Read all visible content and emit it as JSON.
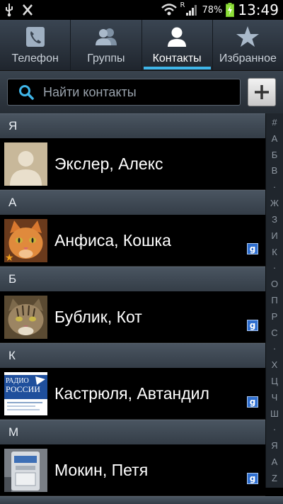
{
  "status_bar": {
    "icons_left": [
      "usb-icon",
      "debug-icon"
    ],
    "signal_label": "R",
    "battery_percent": "78%",
    "time": "13:49"
  },
  "tabs": [
    {
      "label": "Телефон",
      "icon": "phone-icon",
      "active": false
    },
    {
      "label": "Группы",
      "icon": "groups-icon",
      "active": false
    },
    {
      "label": "Контакты",
      "icon": "contact-icon",
      "active": true
    },
    {
      "label": "Избранное",
      "icon": "star-icon",
      "active": false
    }
  ],
  "search": {
    "placeholder": "Найти контакты",
    "add_label": "+"
  },
  "sections": [
    {
      "letter": "Я",
      "contacts": [
        {
          "name": "Экслер, Алекс",
          "avatar": "placeholder",
          "google": false,
          "favorite": false
        }
      ]
    },
    {
      "letter": "А",
      "contacts": [
        {
          "name": "Анфиса, Кошка",
          "avatar": "orange-cat",
          "google": true,
          "favorite": true
        }
      ]
    },
    {
      "letter": "Б",
      "contacts": [
        {
          "name": "Бублик, Кот",
          "avatar": "tabby-cat",
          "google": true,
          "favorite": false
        }
      ]
    },
    {
      "letter": "К",
      "contacts": [
        {
          "name": "Кастрюля, Автандил",
          "avatar": "radio-rossii",
          "google": true,
          "favorite": false
        }
      ]
    },
    {
      "letter": "М",
      "contacts": [
        {
          "name": "Мокин, Петя",
          "avatar": "appliance",
          "google": true,
          "favorite": false
        }
      ]
    }
  ],
  "avatar_text": {
    "radio_line1": "РАДИО",
    "radio_line2": "РОССИИ"
  },
  "google_badge": "g",
  "index_letters": [
    "#",
    "А",
    "Б",
    "В",
    "·",
    "Ж",
    "З",
    "И",
    "К",
    "·",
    "О",
    "П",
    "Р",
    "С",
    "·",
    "Х",
    "Ц",
    "Ч",
    "Ш",
    "·",
    "Я",
    "A",
    "Z"
  ],
  "colors": {
    "accent": "#3fb5e8",
    "google_badge": "#2f6fd0",
    "favorite_star": "#f4a21d"
  }
}
